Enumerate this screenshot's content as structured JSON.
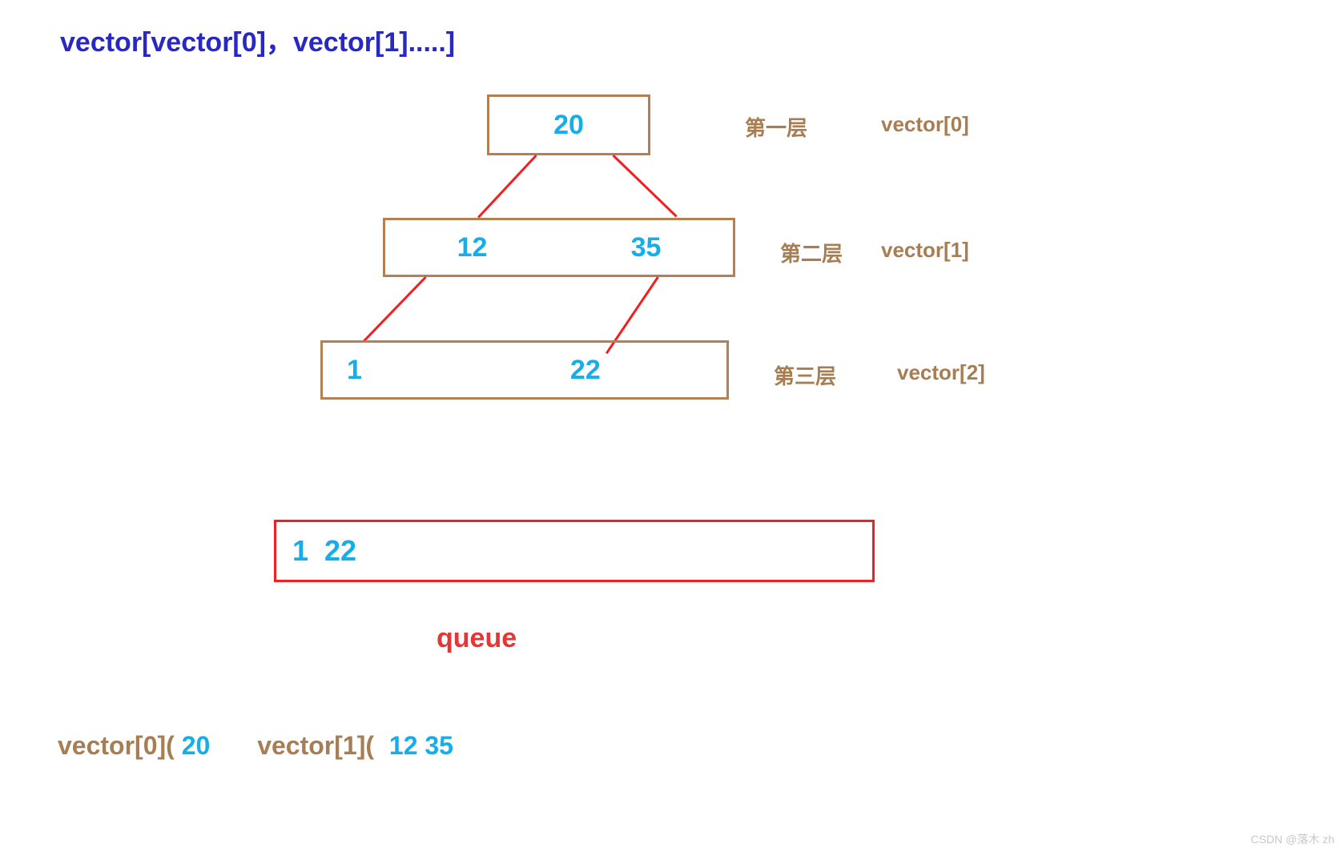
{
  "title": "vector[vector[0]，vector[1].....]",
  "levels": {
    "l0": {
      "values": [
        "20"
      ],
      "label": "第一层",
      "vec": "vector[0]"
    },
    "l1": {
      "values": [
        "12",
        "35"
      ],
      "label": "第二层",
      "vec": "vector[1]"
    },
    "l2": {
      "values": [
        "1",
        "22"
      ],
      "label": "第三层",
      "vec": "vector[2]"
    }
  },
  "queue": {
    "items": [
      "1",
      "22"
    ],
    "label": "queue"
  },
  "result": {
    "parts": [
      "vector[0](",
      "20",
      "vector[1](",
      "12",
      " ",
      "35"
    ]
  },
  "watermark": "CSDN @落木 zh"
}
